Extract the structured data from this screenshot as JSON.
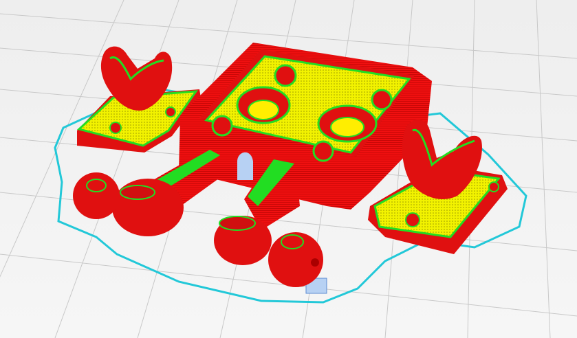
{
  "app": {
    "view": "layer-preview"
  },
  "colors": {
    "background": "#f2f2f2",
    "grid": "#c9c9c9",
    "outer_wall": "#ff1010",
    "inner_wall": "#22dd22",
    "infill": "#f2f200",
    "skirt": "#22c8d8",
    "support": "#a9c9f0"
  },
  "objects": [
    {
      "name": "tray-box",
      "type": "model"
    },
    {
      "name": "left-arm-mount",
      "type": "model"
    },
    {
      "name": "right-arm-mount",
      "type": "model"
    },
    {
      "name": "left-arm-ball",
      "type": "model"
    },
    {
      "name": "front-arm-ball",
      "type": "model"
    },
    {
      "name": "skirt",
      "type": "skirt"
    }
  ]
}
